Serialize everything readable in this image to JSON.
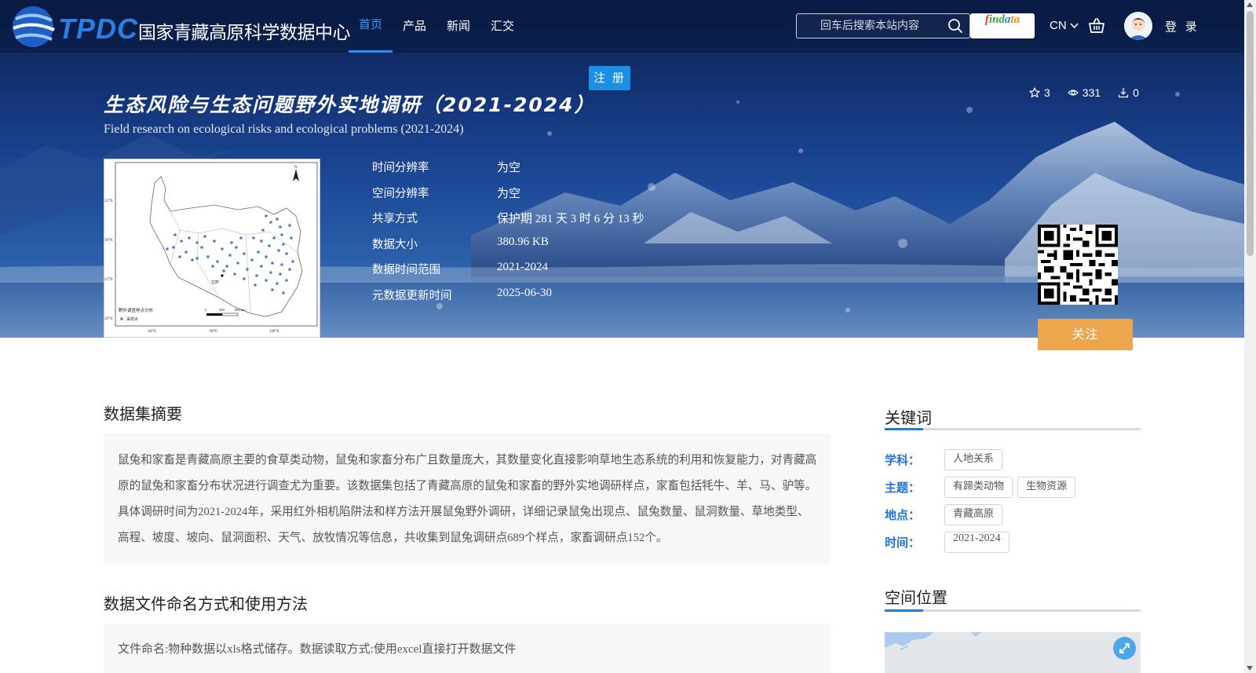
{
  "header": {
    "logo_abbr": "TPDC",
    "logo_name": "国家青藏高原科学数据中心",
    "nav": [
      {
        "label": "首页",
        "active": true
      },
      {
        "label": "产品",
        "active": false
      },
      {
        "label": "新闻",
        "active": false
      },
      {
        "label": "汇交",
        "active": false
      }
    ],
    "search_placeholder": "回车后搜索本站内容",
    "findata_label": [
      "f",
      "ind",
      "a",
      "ta"
    ],
    "language": "CN",
    "login": "登 录",
    "register": "注 册"
  },
  "dataset": {
    "title_cn": "生态风险与生态问题野外实地调研（2021-2024）",
    "title_en": "Field research on ecological risks and ecological problems (2021-2024)",
    "stats": {
      "favorites": "3",
      "views": "331",
      "downloads": "0"
    },
    "meta": [
      {
        "label": "时间分辨率",
        "value": "为空"
      },
      {
        "label": "空间分辨率",
        "value": "为空"
      },
      {
        "label": "共享方式",
        "value": "保护期 281 天 3 时 6 分 13 秒"
      },
      {
        "label": "数据大小",
        "value": "380.96 KB"
      },
      {
        "label": "数据时间范围",
        "value": "2021-2024"
      },
      {
        "label": "元数据更新时间",
        "value": "2025-06-30"
      }
    ],
    "follow": "关注",
    "thumbnail": {
      "legend_title": "野外调查样点分布",
      "legend_item": "采样点",
      "lat_labels": [
        "35°N",
        "30°N",
        "25°N",
        "20°N"
      ],
      "lon_labels": [
        "80°E",
        "90°E",
        "100°E"
      ],
      "city_label": "拉萨",
      "scale_labels": [
        "0",
        "300",
        "600 km"
      ],
      "north_label": "N"
    }
  },
  "abstract": {
    "title": "数据集摘要",
    "text": "鼠兔和家畜是青藏高原主要的食草类动物，鼠兔和家畜分布广且数量庞大，其数量变化直接影响草地生态系统的利用和恢复能力，对青藏高原的鼠兔和家畜分布状况进行调查尤为重要。该数据集包括了青藏高原的鼠兔和家畜的野外实地调研样点，家畜包括牦牛、羊、马、驴等。具体调研时间为2021-2024年，采用红外相机陷阱法和样方法开展鼠兔野外调研，详细记录鼠兔出现点、鼠兔数量、鼠洞数量、草地类型、高程、坡度、坡向、鼠洞面积、天气、放牧情况等信息，共收集到鼠兔调研点689个样点，家畜调研点152个。"
  },
  "naming": {
    "title": "数据文件命名方式和使用方法",
    "text": "文件命名:物种数据以xls格式储存。数据读取方式:使用excel直接打开数据文件"
  },
  "keywords": {
    "title": "关键词",
    "rows": [
      {
        "label": "学科：",
        "tags": [
          "人地关系"
        ]
      },
      {
        "label": "主题：",
        "tags": [
          "有蹄类动物",
          "生物资源"
        ]
      },
      {
        "label": "地点：",
        "tags": [
          "青藏高原"
        ]
      },
      {
        "label": "时间：",
        "tags": [
          "2021-2024"
        ]
      }
    ]
  },
  "location": {
    "title": "空间位置"
  },
  "colors": {
    "accent": "#2d8cf0",
    "follow": "#eca64d",
    "keyword_label": "#2271d6",
    "register": "#1a8fe3"
  }
}
